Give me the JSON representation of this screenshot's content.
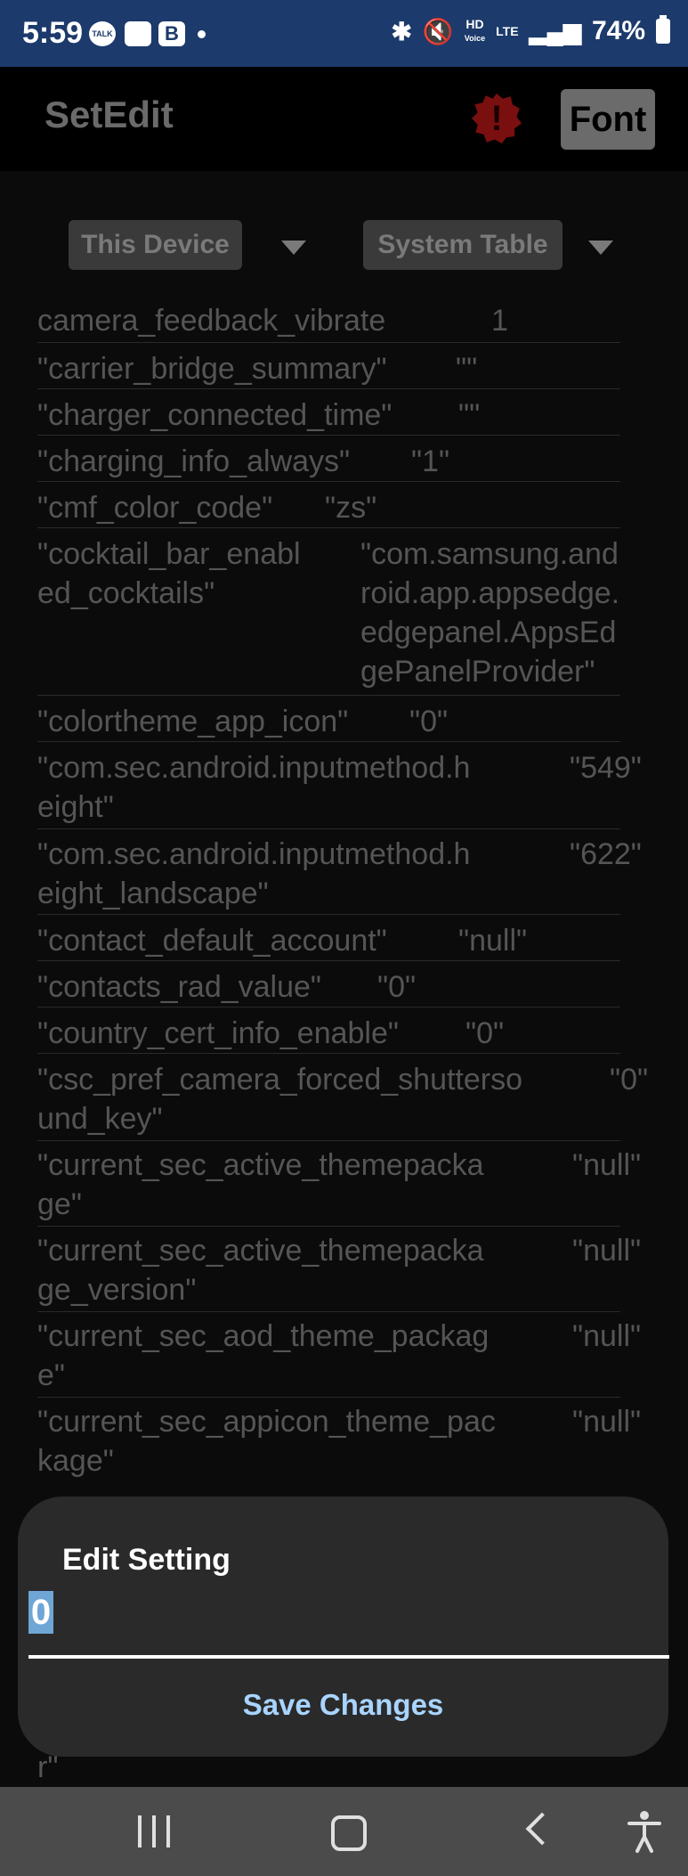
{
  "status_bar": {
    "time": "5:59",
    "talk_label": "TALK",
    "network": "LTE",
    "hd_voice": "HD",
    "battery": "74%"
  },
  "app_bar": {
    "title": "SetEdit",
    "alert_symbol": "!",
    "font_button": "Font"
  },
  "selectors": {
    "device": "This Device",
    "table": "System Table"
  },
  "settings": [
    {
      "key": "camera_feedback_vibrate",
      "value": "1"
    },
    {
      "key": "\"carrier_bridge_summary\"",
      "value": "\"\""
    },
    {
      "key": "\"charger_connected_time\"",
      "value": "\"\""
    },
    {
      "key": "\"charging_info_always\"",
      "value": "\"1\""
    },
    {
      "key": "\"cmf_color_code\"",
      "value": "\"zs\""
    },
    {
      "key": "\"cocktail_bar_enabl\ned_cocktails\"",
      "value": "\"com.samsung.and\nroid.app.appsedge.\nedgepanel.AppsEd\ngePanelProvider\""
    },
    {
      "key": "\"colortheme_app_icon\"",
      "value": "\"0\""
    },
    {
      "key": "\"com.sec.android.inputmethod.h\neight\"",
      "value": "\"549\""
    },
    {
      "key": "\"com.sec.android.inputmethod.h\neight_landscape\"",
      "value": "\"622\""
    },
    {
      "key": "\"contact_default_account\"",
      "value": "\"null\""
    },
    {
      "key": "\"contacts_rad_value\"",
      "value": "\"0\""
    },
    {
      "key": "\"country_cert_info_enable\"",
      "value": "\"0\""
    },
    {
      "key": "\"csc_pref_camera_forced_shutterso\nund_key\"",
      "value": "\"0\""
    },
    {
      "key": "\"current_sec_active_themepacka\nge\"",
      "value": "\"null\""
    },
    {
      "key": "\"current_sec_active_themepacka\nge_version\"",
      "value": "\"null\""
    },
    {
      "key": "\"current_sec_aod_theme_packag\ne\"",
      "value": "\"null\""
    },
    {
      "key": "\"current_sec_appicon_theme_pac\nkage\"",
      "value": "\"null\""
    }
  ],
  "dialog": {
    "title": "Edit Setting",
    "value": "0",
    "save_label": "Save Changes"
  },
  "partial_row_text": "r\"",
  "icons": {
    "recents": "recents-icon",
    "home": "home-icon",
    "back": "back-icon",
    "accessibility": "accessibility-icon"
  }
}
